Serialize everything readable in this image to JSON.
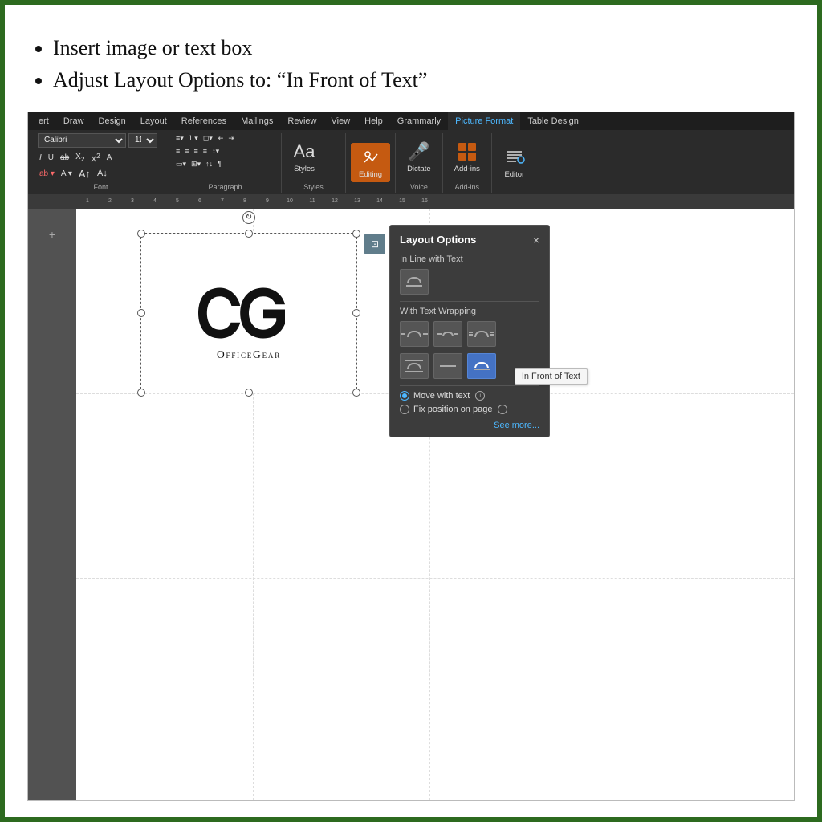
{
  "page": {
    "border_color": "#2d6a1f",
    "background": "#fff"
  },
  "bullets": {
    "item1": "Insert image or text box",
    "item2": "Adjust Layout Options to: “In Front of Text”"
  },
  "ribbon": {
    "tabs": [
      {
        "label": "ert",
        "active": false
      },
      {
        "label": "Draw",
        "active": false
      },
      {
        "label": "Design",
        "active": false
      },
      {
        "label": "Layout",
        "active": false
      },
      {
        "label": "References",
        "active": false
      },
      {
        "label": "Mailings",
        "active": false
      },
      {
        "label": "Review",
        "active": false
      },
      {
        "label": "View",
        "active": false
      },
      {
        "label": "Help",
        "active": false
      },
      {
        "label": "Grammarly",
        "active": false
      },
      {
        "label": "Picture Format",
        "active": true,
        "color": "picture-format"
      },
      {
        "label": "Table Design",
        "active": false
      }
    ],
    "font_group": {
      "label": "Font",
      "font_name": "Calibri",
      "font_size": "11"
    },
    "paragraph_group": {
      "label": "Paragraph"
    },
    "styles_group": {
      "label": "Styles"
    },
    "buttons": {
      "styles": "Styles",
      "editing": "Editing",
      "dictate": "Dictate",
      "add_ins": "Add-ins",
      "editor": "Editor",
      "grammarly": "Grammarly"
    },
    "voice_label": "Voice",
    "addins_label": "Add-ins"
  },
  "ruler": {
    "marks": [
      "1",
      "2",
      "3",
      "4",
      "5",
      "6",
      "7",
      "8",
      "9",
      "10",
      "11",
      "12",
      "13",
      "14",
      "15",
      "16"
    ]
  },
  "layout_options": {
    "title": "Layout Options",
    "close_label": "×",
    "inline_section": "In Line with Text",
    "wrapping_section": "With Text Wrapping",
    "radio_move": "Move with text",
    "radio_fix": "Fix position on page",
    "see_more": "See more...",
    "tooltip": "In Front of Text"
  },
  "logo": {
    "text": "OfficeGear"
  },
  "doc_move_handle": "+"
}
